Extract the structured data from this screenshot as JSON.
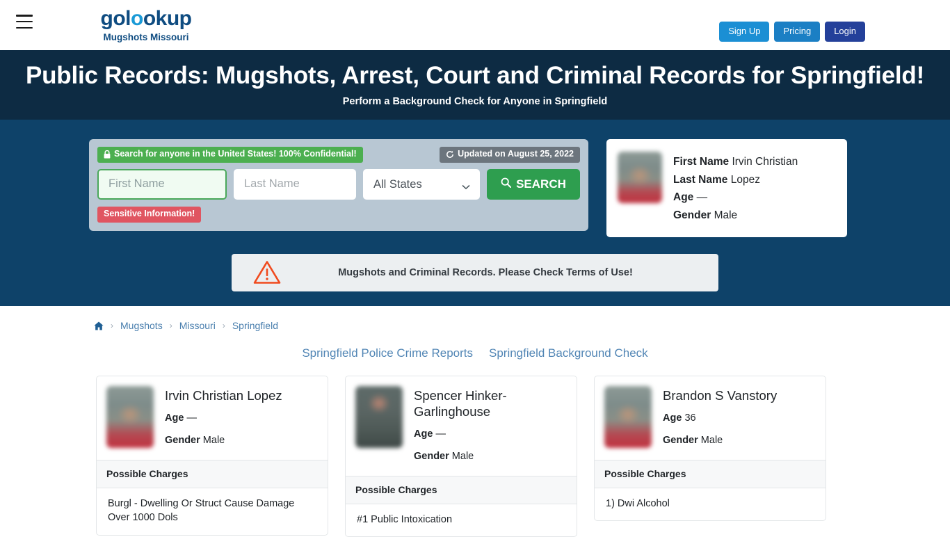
{
  "header": {
    "menu_icon": "hamburger-icon",
    "logo_text_part1": "gol",
    "logo_text_o": "o",
    "logo_text_part2": "okup",
    "logo_subtitle": "Mugshots Missouri",
    "signup_label": "Sign Up",
    "pricing_label": "Pricing",
    "login_label": "Login",
    "color_signup": "#1b8fd4",
    "color_pricing": "#1b7fc4",
    "color_login": "#24409a"
  },
  "hero": {
    "title": "Public Records: Mugshots, Arrest, Court and Criminal Records for Springfield!",
    "subtitle": "Perform a Background Check for Anyone in Springfield",
    "band_color": "#0d2b43",
    "section_color": "#0e4269"
  },
  "search": {
    "confidential_badge": "Search for anyone in the United States! 100% Confidential!",
    "confidential_icon": "lock-icon",
    "updated_badge": "Updated on August 25, 2022",
    "updated_icon": "refresh-icon",
    "first_name_placeholder": "First Name",
    "first_name_value": "",
    "last_name_placeholder": "Last Name",
    "last_name_value": "",
    "state_selected": "All States",
    "state_options": [
      "All States"
    ],
    "search_button": "SEARCH",
    "search_icon": "search-icon",
    "sensitive_badge": "Sensitive Information!",
    "color_confidential": "#4caf50",
    "color_updated": "#6c757d",
    "color_sensitive": "#e05561",
    "color_search_button": "#2e9e4f"
  },
  "hero_person": {
    "avatar": "blurred-mugshot",
    "first_name_label": "First Name",
    "first_name_value": "Irvin Christian",
    "last_name_label": "Last Name",
    "last_name_value": "Lopez",
    "age_label": "Age",
    "age_value": "—",
    "gender_label": "Gender",
    "gender_value": "Male"
  },
  "warning": {
    "icon": "alert-triangle-icon",
    "text": "Mugshots and Criminal Records. Please Check Terms of Use!"
  },
  "breadcrumb": {
    "home_icon": "home-icon",
    "separator": "›",
    "items": [
      {
        "label": "Mugshots"
      },
      {
        "label": "Missouri"
      },
      {
        "label": "Springfield"
      }
    ]
  },
  "quicklinks": [
    {
      "label": "Springfield Police Crime Reports"
    },
    {
      "label": "Springfield Background Check"
    }
  ],
  "charges_header": "Possible Charges",
  "results": [
    {
      "avatar": "blurred-mugshot",
      "name": "Irvin Christian Lopez",
      "age_label": "Age",
      "age_value": "—",
      "gender_label": "Gender",
      "gender_value": "Male",
      "charges_header": "Possible Charges",
      "charge": "Burgl - Dwelling Or Struct Cause Damage Over 1000 Dols"
    },
    {
      "avatar": "blurred-mugshot-dark",
      "name": "Spencer Hinker-Garlinghouse",
      "age_label": "Age",
      "age_value": "—",
      "gender_label": "Gender",
      "gender_value": "Male",
      "charges_header": "Possible Charges",
      "charge": "#1 Public Intoxication"
    },
    {
      "avatar": "blurred-mugshot",
      "name": "Brandon S Vanstory",
      "age_label": "Age",
      "age_value": "36",
      "gender_label": "Gender",
      "gender_value": "Male",
      "charges_header": "Possible Charges",
      "charge": "1) Dwi Alcohol"
    }
  ]
}
